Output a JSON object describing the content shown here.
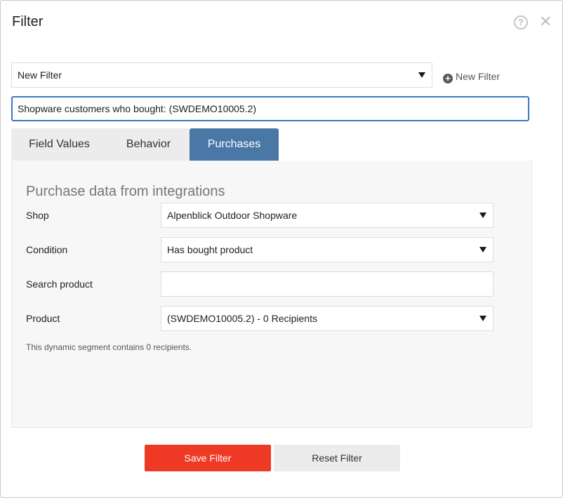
{
  "dialog": {
    "title": "Filter",
    "help_icon": "?",
    "close_icon": "✕"
  },
  "filter_select": {
    "value": "New Filter"
  },
  "new_filter": {
    "icon": "+",
    "label": "New Filter"
  },
  "filter_name": {
    "value": "Shopware customers who bought: (SWDEMO10005.2)"
  },
  "tabs": [
    {
      "label": "Field Values",
      "active": false
    },
    {
      "label": "Behavior",
      "active": false
    },
    {
      "label": "Purchases",
      "active": true
    }
  ],
  "purchases": {
    "section_title": "Purchase data from integrations",
    "shop": {
      "label": "Shop",
      "value": "Alpenblick Outdoor Shopware"
    },
    "condition": {
      "label": "Condition",
      "value": "Has bought product"
    },
    "search_product": {
      "label": "Search product",
      "value": ""
    },
    "product": {
      "label": "Product",
      "value": "(SWDEMO10005.2) - 0 Recipients"
    },
    "hint": "This dynamic segment contains 0 recipients."
  },
  "buttons": {
    "save": "Save Filter",
    "reset": "Reset Filter"
  },
  "colors": {
    "accent_tab": "#4a78a6",
    "save_button": "#ee3a25",
    "input_focus_border": "#3b79c2"
  }
}
